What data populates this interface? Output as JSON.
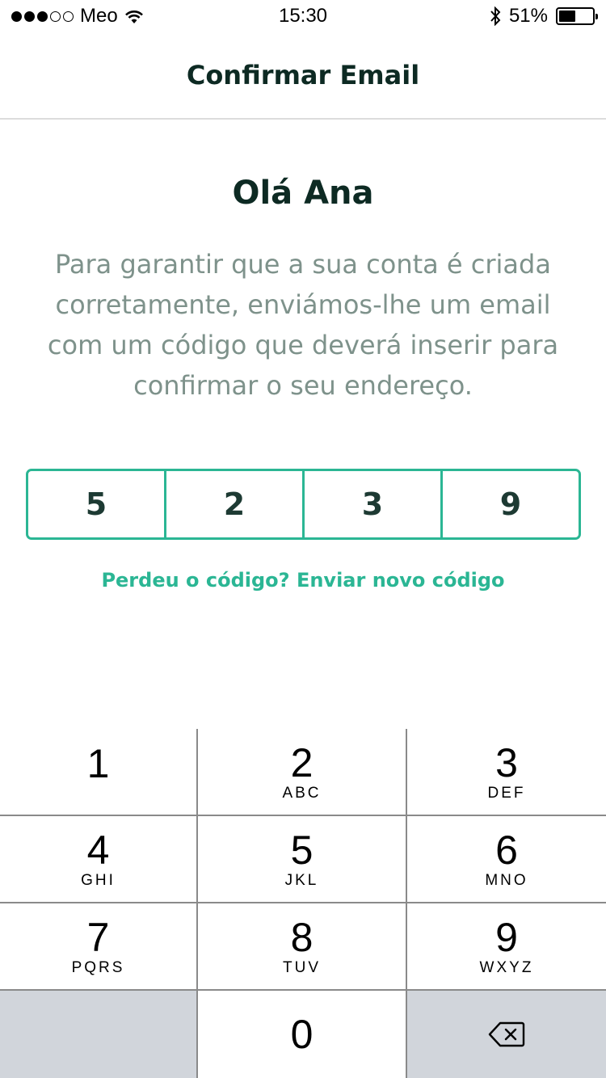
{
  "status_bar": {
    "carrier": "Meo",
    "signal_bars_filled": 3,
    "signal_bars_total": 5,
    "time": "15:30",
    "battery_percent": "51%",
    "battery_level": 0.51
  },
  "nav": {
    "title": "Confirmar Email"
  },
  "main": {
    "greeting": "Olá Ana",
    "description": "Para garantir que a sua conta é criada corretamente, enviámos-lhe um email com um código que deverá inserir para confirmar o seu endereço.",
    "code_digits": [
      "5",
      "2",
      "3",
      "9"
    ],
    "resend_link": "Perdeu o código? Enviar novo código"
  },
  "keypad": {
    "keys": [
      {
        "num": "1",
        "letters": ""
      },
      {
        "num": "2",
        "letters": "ABC"
      },
      {
        "num": "3",
        "letters": "DEF"
      },
      {
        "num": "4",
        "letters": "GHI"
      },
      {
        "num": "5",
        "letters": "JKL"
      },
      {
        "num": "6",
        "letters": "MNO"
      },
      {
        "num": "7",
        "letters": "PQRS"
      },
      {
        "num": "8",
        "letters": "TUV"
      },
      {
        "num": "9",
        "letters": "WXYZ"
      },
      {
        "num": "0",
        "letters": ""
      }
    ],
    "delete_icon": "backspace-icon"
  },
  "colors": {
    "accent": "#2bb694",
    "title_text": "#0d2a23",
    "body_text": "#7e928b",
    "keypad_gray": "#d1d5db"
  }
}
